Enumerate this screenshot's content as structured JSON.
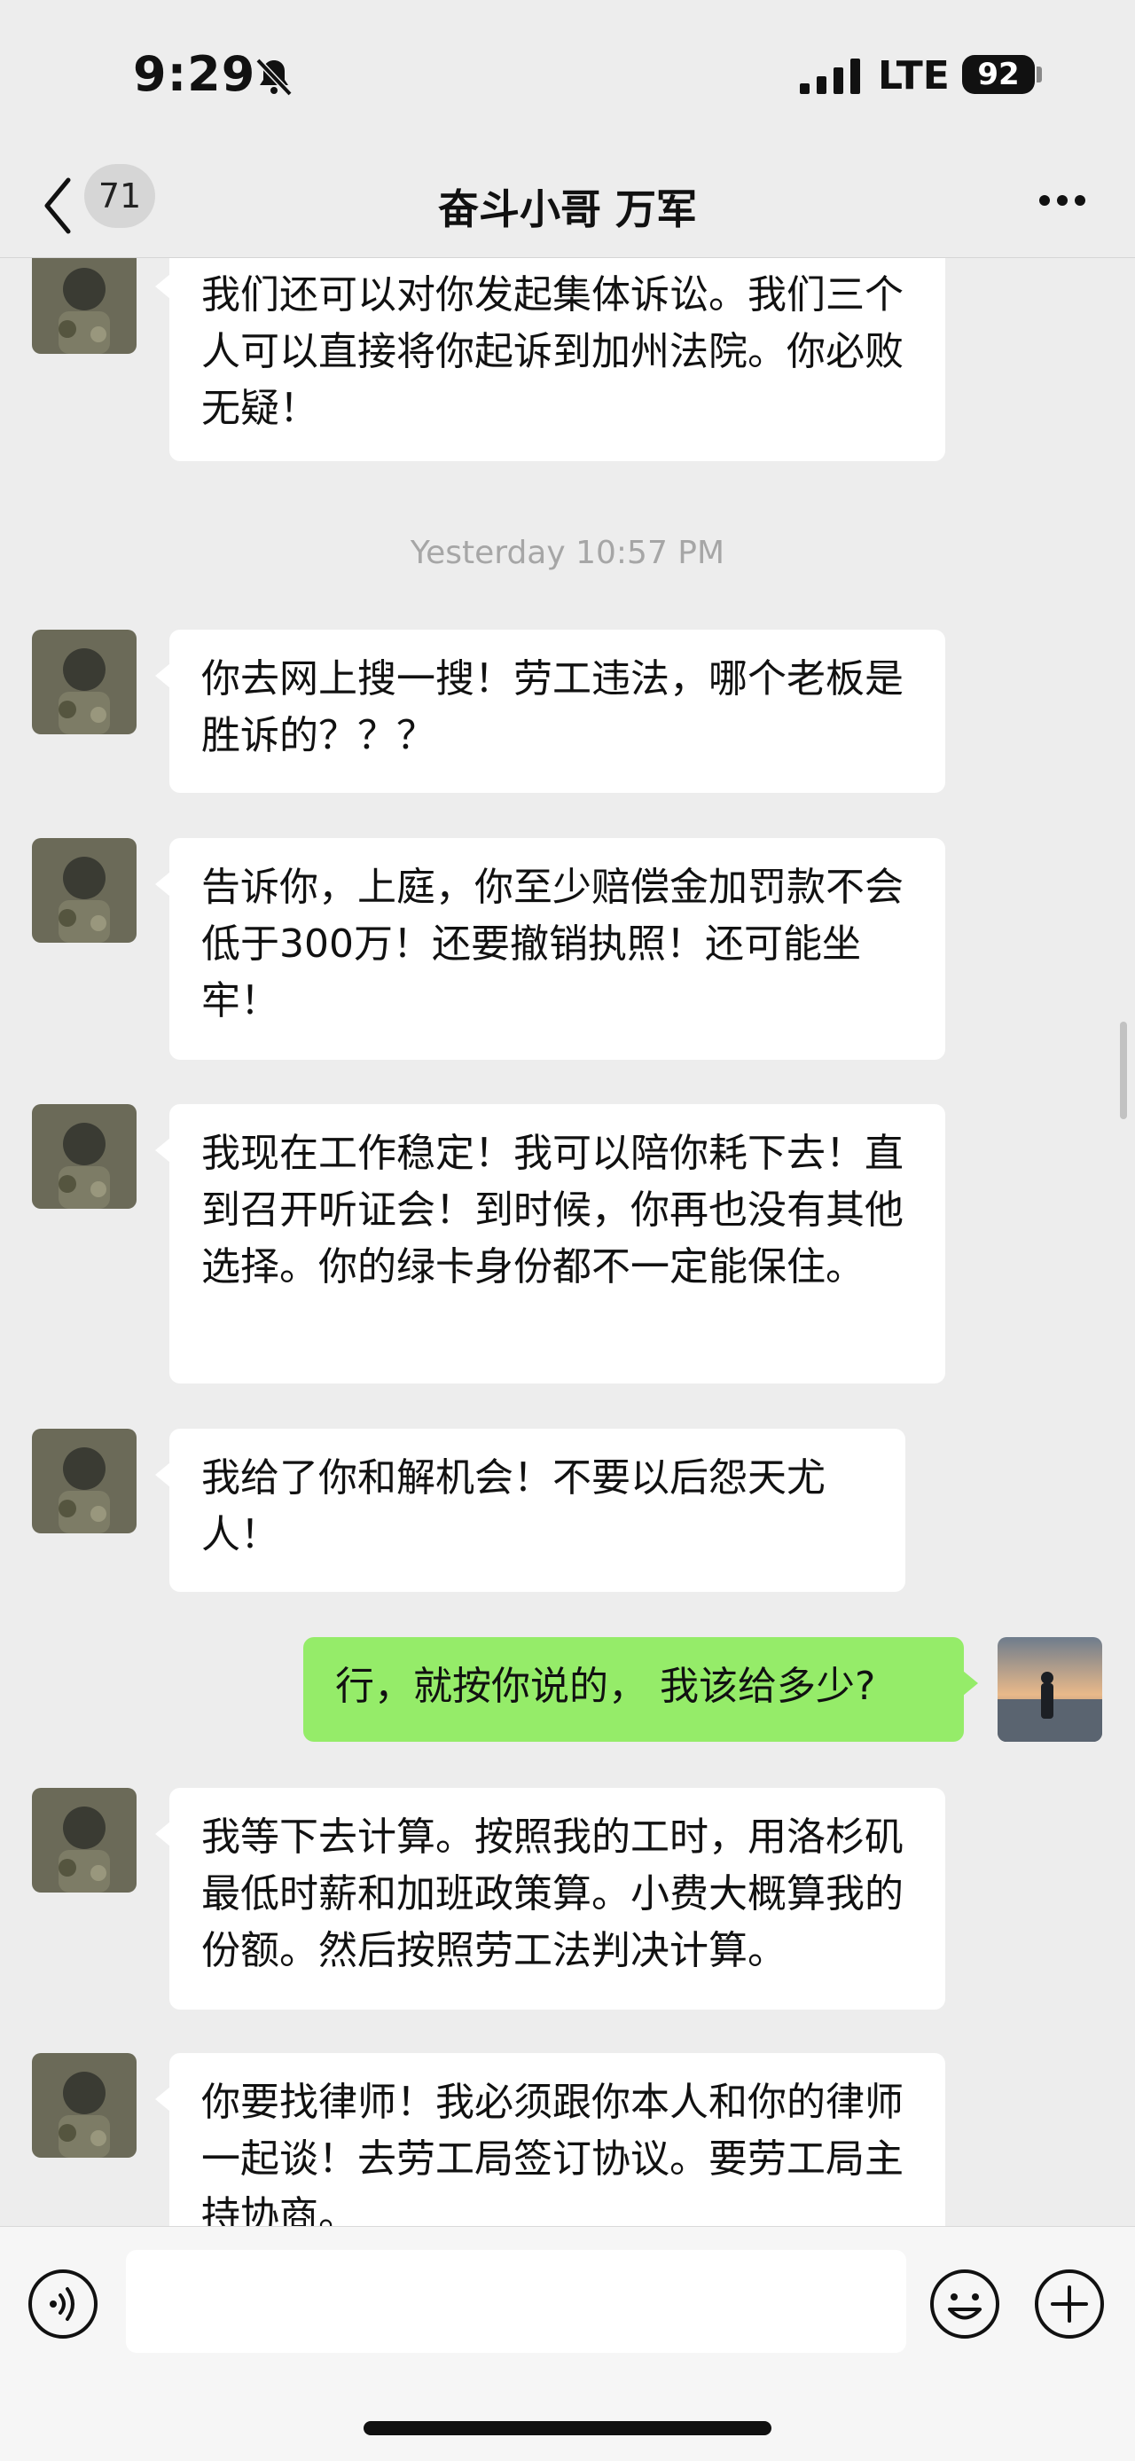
{
  "status_bar": {
    "time": "9:29",
    "network": "LTE",
    "battery": "92",
    "icons": [
      "bell-slash-icon",
      "signal-icon",
      "battery-icon"
    ]
  },
  "nav": {
    "back_icon": "chevron-left-icon",
    "unread_count": "71",
    "title": "奋斗小哥 万军",
    "more_icon": "ellipsis-icon"
  },
  "messages": [
    {
      "side": "left",
      "text": "我们还可以对你发起集体诉讼。我们三个人可以直接将你起诉到加州法院。你必败无疑！"
    },
    {
      "type": "time",
      "text": "Yesterday 10:57 PM"
    },
    {
      "side": "left",
      "text": "你去网上搜一搜！劳工违法，哪个老板是胜诉的？？？"
    },
    {
      "side": "left",
      "text": "告诉你，上庭，你至少赔偿金加罚款不会低于300万！还要撤销执照！还可能坐牢！"
    },
    {
      "side": "left",
      "text": "我现在工作稳定！我可以陪你耗下去！直到召开听证会！到时候，你再也没有其他选择。你的绿卡身份都不一定能保住。"
    },
    {
      "side": "left",
      "text": "我给了你和解机会！不要以后怨天尤人！"
    },
    {
      "side": "right",
      "text": "行，就按你说的， 我该给多少?"
    },
    {
      "side": "left",
      "text": "我等下去计算。按照我的工时，用洛杉矶最低时薪和加班政策算。小费大概算我的份额。然后按照劳工法判决计算。"
    },
    {
      "side": "left",
      "text": "你要找律师！我必须跟你本人和你的律师一起谈！去劳工局签订协议。要劳工局主持协商。"
    }
  ],
  "input_bar": {
    "voice_icon": "voice-icon",
    "text_value": "",
    "emoji_icon": "smiley-icon",
    "plus_icon": "plus-icon"
  },
  "colors": {
    "background": "#ededed",
    "bubble_incoming": "#ffffff",
    "bubble_outgoing": "#95ec69",
    "timestamp": "#a6a6a6"
  }
}
